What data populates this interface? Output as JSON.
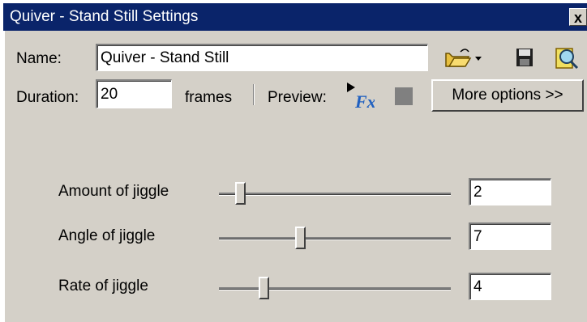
{
  "window": {
    "title": "Quiver - Stand Still Settings",
    "close_glyph": "x"
  },
  "name_row": {
    "label": "Name:",
    "value": "Quiver - Stand Still"
  },
  "toolbar": {
    "open_icon": "folder-open-icon",
    "save_icon": "floppy-disk-icon",
    "find_icon": "magnifier-icon"
  },
  "duration_row": {
    "label": "Duration:",
    "value": "20",
    "unit": "frames",
    "preview_label": "Preview:",
    "more_options_label": "More options >>"
  },
  "sliders": [
    {
      "label": "Amount of jiggle",
      "value": "2",
      "position": 0.07
    },
    {
      "label": "Angle of jiggle",
      "value": "7",
      "position": 0.33
    },
    {
      "label": "Rate of jiggle",
      "value": "4",
      "position": 0.17
    }
  ],
  "colors": {
    "titlebar": "#0a246a",
    "face": "#d4d0c8",
    "accent_icon": "#2060c0"
  }
}
